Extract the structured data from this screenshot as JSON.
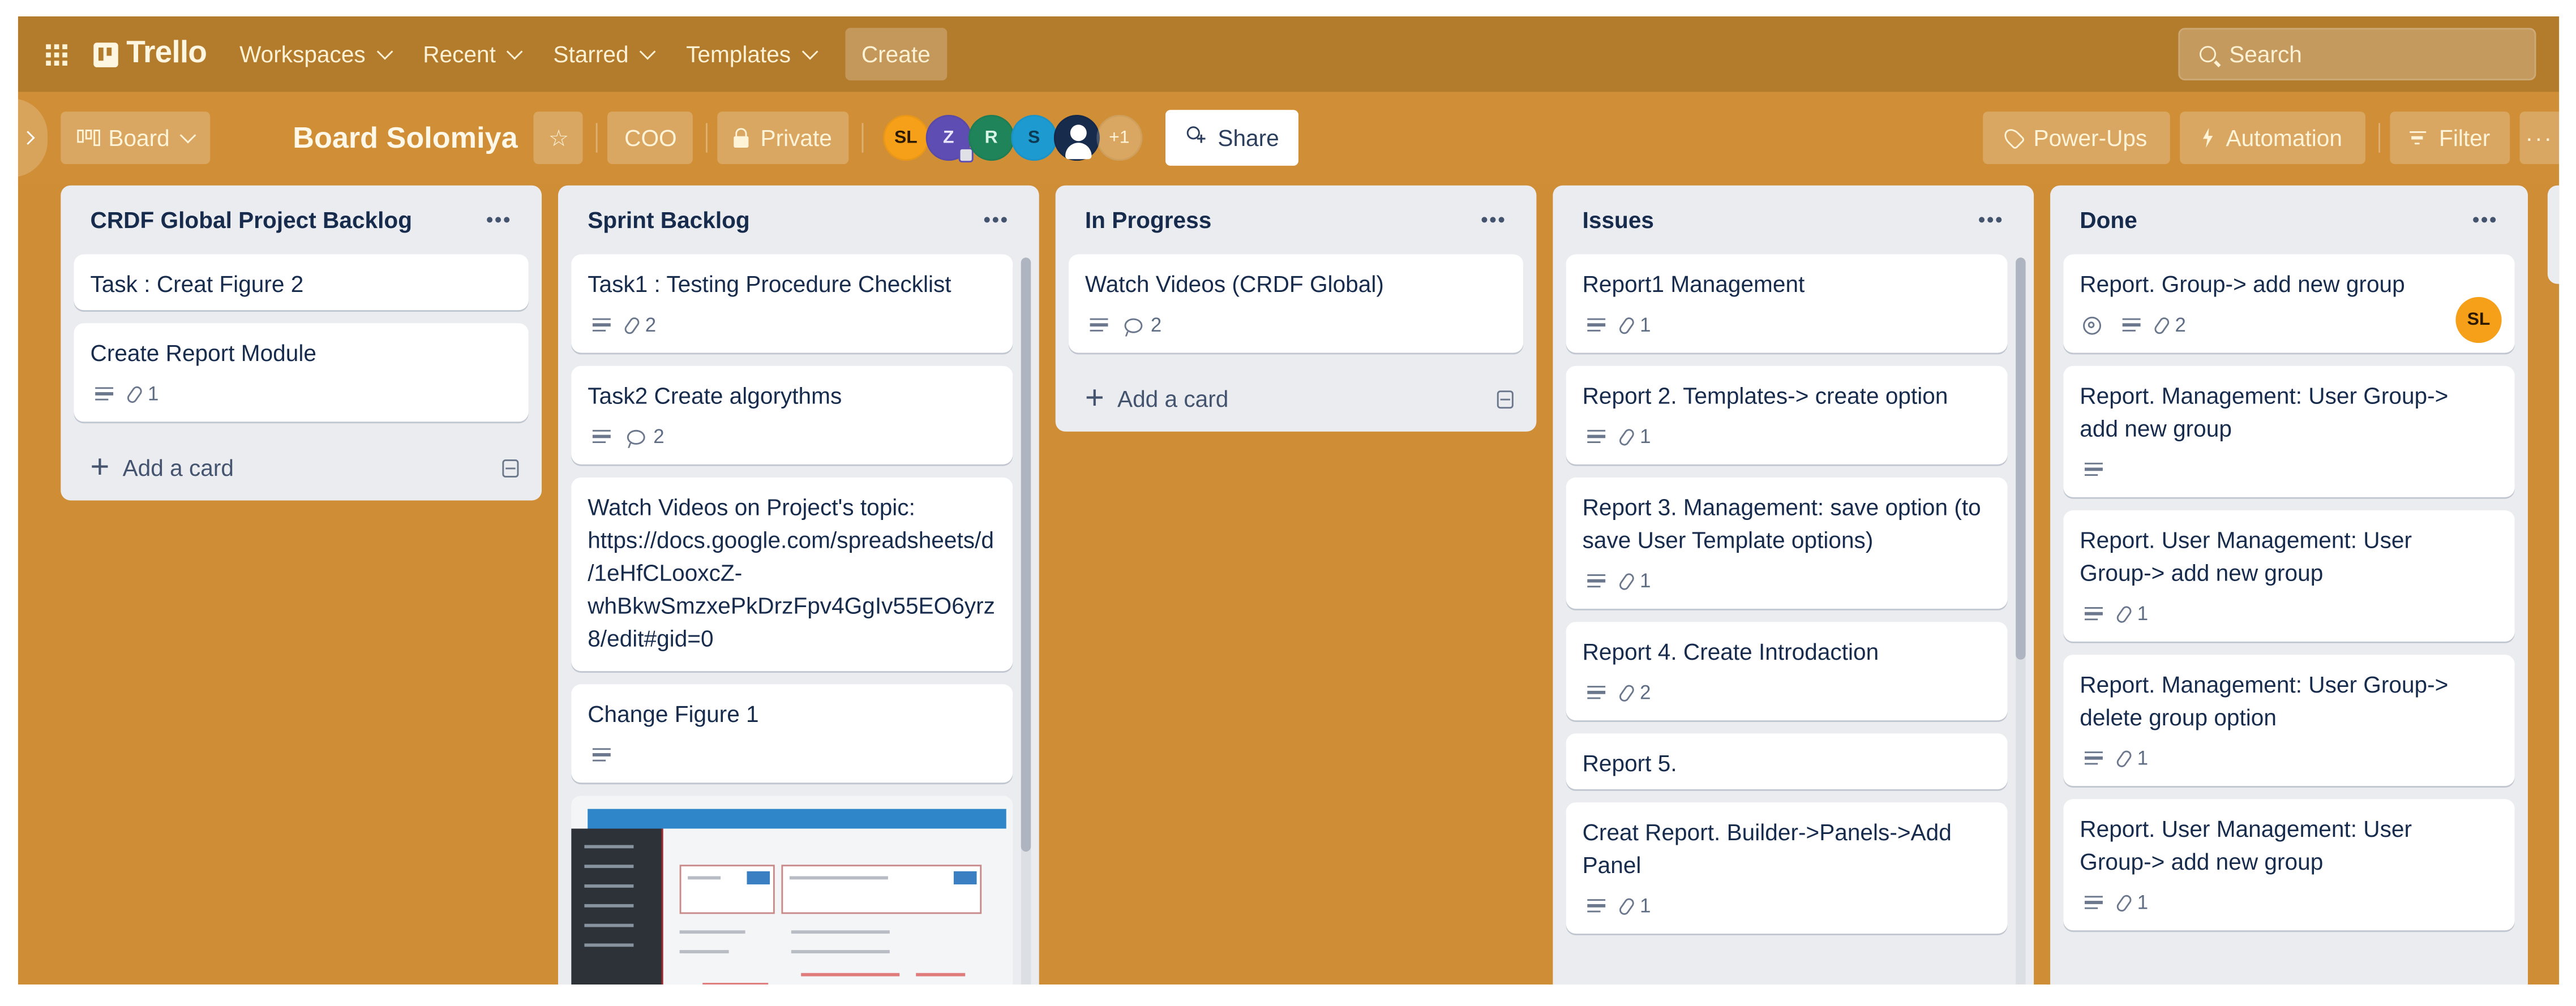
{
  "topbar": {
    "app_name": "Trello",
    "nav": [
      {
        "label": "Workspaces"
      },
      {
        "label": "Recent"
      },
      {
        "label": "Starred"
      },
      {
        "label": "Templates"
      }
    ],
    "create_label": "Create",
    "search_placeholder": "Search"
  },
  "board": {
    "view_label": "Board",
    "title": "Board Solomiya",
    "workspace_label": "COO",
    "visibility_label": "Private",
    "members": [
      {
        "initials": "SL",
        "bg": "#f6a01a",
        "fg": "#2b1a00"
      },
      {
        "initials": "Z",
        "bg": "#5e4db2",
        "fg": "#e9e6ff",
        "admin": true
      },
      {
        "initials": "R",
        "bg": "#1f845a",
        "fg": "#d7f5e6"
      },
      {
        "initials": "S",
        "bg": "#1d9bd1",
        "fg": "#0b3a52"
      },
      {
        "initials": "",
        "bg": "#172b4d",
        "fg": "#ffffff",
        "default_avatar": true
      }
    ],
    "more_members": "+1",
    "share_label": "Share",
    "powerups_label": "Power-Ups",
    "automation_label": "Automation",
    "filter_label": "Filter",
    "more_label": "···"
  },
  "lists": [
    {
      "title": "CRDF Global Project Backlog",
      "add_card_label": "Add a card",
      "cards": [
        {
          "title": "Task : Creat Figure 2"
        },
        {
          "title": "Create Report Module",
          "description": true,
          "attachments": "1"
        }
      ]
    },
    {
      "title": "Sprint Backlog",
      "cards": [
        {
          "title": "Task1 : Testing Procedure Checklist",
          "description": true,
          "attachments": "2"
        },
        {
          "title": "Task2 Create algorythms",
          "description": true,
          "comments": "2"
        },
        {
          "title": "Watch Videos on Project's topic: https://docs.google.com/spreadsheets/d/1eHfCLooxcZ-whBkwSmzxePkDrzFpv4GgIv55EO6yrz8/edit#gid=0"
        },
        {
          "title": "Change Figure 1",
          "description": true
        },
        {
          "title": "",
          "cover_image": "annotated-ui-screenshot"
        }
      ]
    },
    {
      "title": "In Progress",
      "add_card_label": "Add a card",
      "cards": [
        {
          "title": "Watch Videos (CRDF Global)",
          "description": true,
          "comments": "2"
        }
      ]
    },
    {
      "title": "Issues",
      "cards": [
        {
          "title": "Report1 Management",
          "description": true,
          "attachments": "1"
        },
        {
          "title": "Report 2. Templates-> create option",
          "description": true,
          "attachments": "1"
        },
        {
          "title": "Report 3. Management: save option (to save User Template options)",
          "description": true,
          "attachments": "1"
        },
        {
          "title": "Report 4. Create Introdaction",
          "description": true,
          "attachments": "2"
        },
        {
          "title": "Report 5."
        },
        {
          "title": "Creat Report. Builder->Panels->Add Panel",
          "description": true,
          "attachments": "1"
        }
      ]
    },
    {
      "title": "Done",
      "cards": [
        {
          "title": "Report. Group-> add new group",
          "watching": true,
          "description": true,
          "attachments": "2",
          "member": {
            "initials": "SL",
            "bg": "#f6a01a",
            "fg": "#2b1a00"
          }
        },
        {
          "title": "Report. Management: User Group-> add new group",
          "description": true
        },
        {
          "title": "Report. User Management: User Group-> add new group",
          "description": true,
          "attachments": "1"
        },
        {
          "title": "Report. Management: User Group-> delete group option",
          "description": true,
          "attachments": "1"
        },
        {
          "title": "Report. User Management: User Group-> add new group",
          "description": true,
          "attachments": "1"
        }
      ]
    }
  ],
  "colors": {
    "topbar": "#b37b2c",
    "board_bg": "#cf8e36",
    "list_bg": "#ebecf0",
    "card_bg": "#ffffff",
    "text": "#172b4d"
  }
}
